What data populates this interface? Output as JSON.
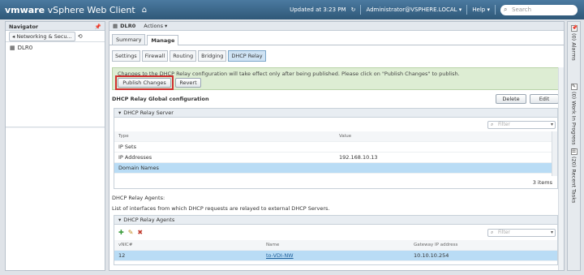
{
  "app": {
    "brand_prefix": "vmware",
    "brand_name": "vSphere Web Client",
    "home_icon": "home-icon"
  },
  "topbar": {
    "updated": "Updated at 3:23 PM",
    "user": "Administrator@VSPHERE.LOCAL ▾",
    "help": "Help ▾",
    "search_placeholder": "Search"
  },
  "navigator": {
    "title": "Navigator",
    "crumb": "◂ Networking & Secu...",
    "items": [
      {
        "label": "DLR0"
      }
    ]
  },
  "main": {
    "object": "DLR0",
    "actions": "Actions ▾",
    "tabs": [
      "Summary",
      "Manage"
    ],
    "subtabs": [
      "Settings",
      "Firewall",
      "Routing",
      "Bridging",
      "DHCP Relay"
    ],
    "notice": "Changes to the DHCP Relay configuration will take effect only after being published. Please click on \"Publish Changes\" to publish.",
    "publish_btn": "Publish Changes",
    "revert_btn": "Revert",
    "global_title": "DHCP Relay Global configuration",
    "delete_btn": "Delete",
    "edit_btn": "Edit",
    "server_section": "DHCP Relay Server",
    "filter_placeholder": "Filter",
    "server_cols": [
      "Type",
      "Value"
    ],
    "server_rows": [
      {
        "type": "IP Sets",
        "value": ""
      },
      {
        "type": "IP Addresses",
        "value": "192.168.10.13"
      },
      {
        "type": "Domain Names",
        "value": ""
      }
    ],
    "server_count": "3 items",
    "agents_title": "DHCP Relay Agents:",
    "agents_desc": "List of interfaces from which DHCP requests are relayed to external DHCP Servers.",
    "agents_section": "DHCP Relay Agents",
    "agent_cols": [
      "vNIC#",
      "Name",
      "Gateway IP address"
    ],
    "agent_rows": [
      {
        "vnic": "12",
        "name": "to-VDI-NW",
        "gateway": "10.10.10.254"
      }
    ]
  },
  "rail": {
    "alarms": "(0) Alarms",
    "wip": "(0) Work In Progress",
    "tasks": "(20) Recent Tasks"
  },
  "colors": {
    "topbar": "#3c6382",
    "notice": "#ddedd3",
    "selected_row": "#b9dcf5",
    "highlight": "#d23030"
  }
}
